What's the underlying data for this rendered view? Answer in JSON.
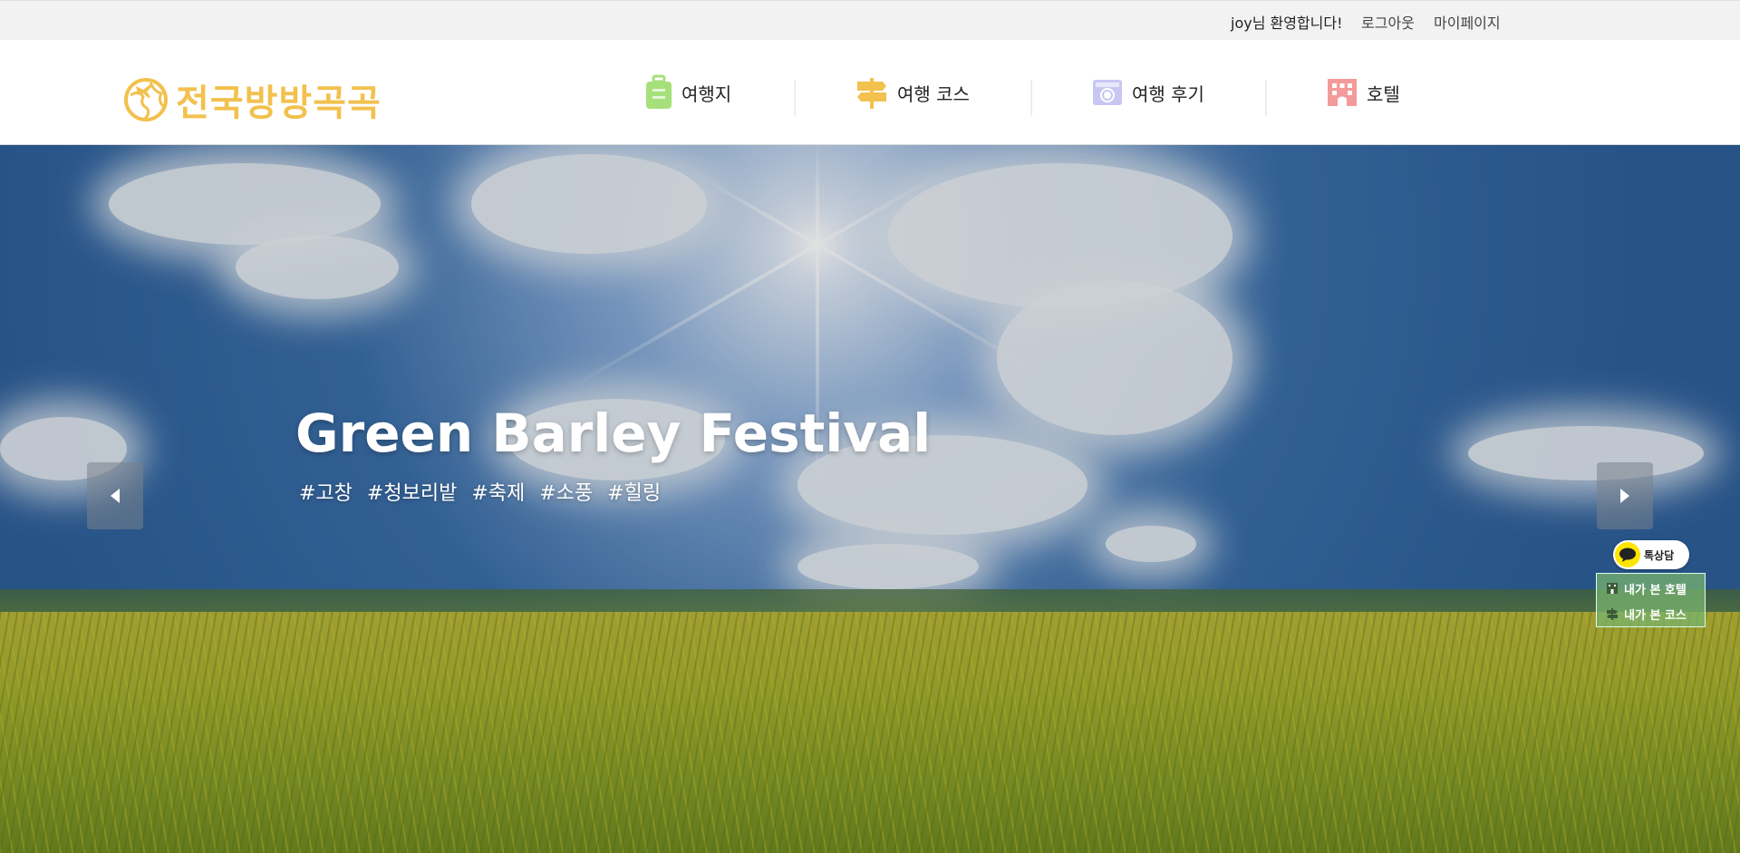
{
  "topbar": {
    "welcome": "joy님 환영합니다!",
    "logout": "로그아웃",
    "mypage": "마이페이지"
  },
  "header": {
    "logo_text": "전국방방곡곡",
    "nav": [
      {
        "label": "여행지",
        "icon": "suitcase-icon",
        "color": "#a6e07a"
      },
      {
        "label": "여행 코스",
        "icon": "signpost-icon",
        "color": "#f2c14e"
      },
      {
        "label": "여행 후기",
        "icon": "camera-icon",
        "color": "#c9c6f2"
      },
      {
        "label": "호텔",
        "icon": "hotel-icon",
        "color": "#f49a9a"
      }
    ]
  },
  "hero": {
    "title": "Green Barley Festival",
    "tags": [
      "#고창",
      "#청보리밭",
      "#축제",
      "#소풍",
      "#힐링"
    ]
  },
  "floating": {
    "kakao_label": "톡상담",
    "recent_hotel": "내가 본 호텔",
    "recent_course": "내가 본 코스"
  },
  "colors": {
    "logo": "#f2c14e",
    "topbar_bg": "#f2f2f2",
    "kakao": "#fee500"
  }
}
